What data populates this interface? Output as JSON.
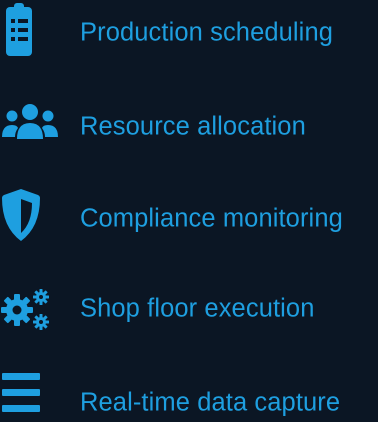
{
  "colors": {
    "background": "#0b1624",
    "accent": "#1e9fe0",
    "text": "#1e9fe0"
  },
  "items": [
    {
      "label": "Production scheduling",
      "icon": "clipboard-list-icon"
    },
    {
      "label": "Resource allocation",
      "icon": "users-icon"
    },
    {
      "label": "Compliance monitoring",
      "icon": "shield-icon"
    },
    {
      "label": "Shop floor execution",
      "icon": "gears-icon"
    },
    {
      "label": "Real-time data capture",
      "icon": "bars-icon"
    }
  ]
}
